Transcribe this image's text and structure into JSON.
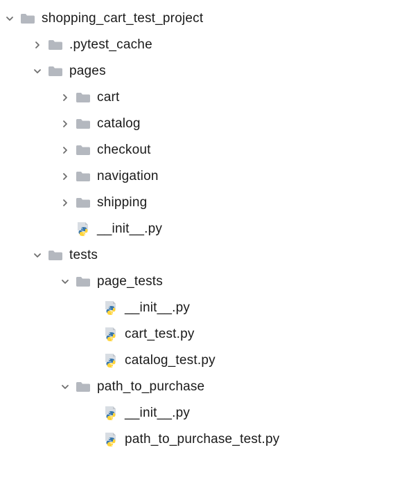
{
  "tree": [
    {
      "id": "root",
      "depth": 0,
      "expanded": true,
      "type": "folder",
      "label": "shopping_cart_test_project"
    },
    {
      "id": "pytest_cache",
      "depth": 1,
      "expanded": false,
      "type": "folder",
      "label": ".pytest_cache"
    },
    {
      "id": "pages",
      "depth": 1,
      "expanded": true,
      "type": "folder",
      "label": "pages"
    },
    {
      "id": "pages_cart",
      "depth": 2,
      "expanded": false,
      "type": "folder",
      "label": "cart"
    },
    {
      "id": "pages_catalog",
      "depth": 2,
      "expanded": false,
      "type": "folder",
      "label": "catalog"
    },
    {
      "id": "pages_checkout",
      "depth": 2,
      "expanded": false,
      "type": "folder",
      "label": "checkout"
    },
    {
      "id": "pages_navigation",
      "depth": 2,
      "expanded": false,
      "type": "folder",
      "label": "navigation"
    },
    {
      "id": "pages_shipping",
      "depth": 2,
      "expanded": false,
      "type": "folder",
      "label": "shipping"
    },
    {
      "id": "pages_init",
      "depth": 2,
      "expanded": null,
      "type": "pyfile",
      "label": "__init__.py"
    },
    {
      "id": "tests",
      "depth": 1,
      "expanded": true,
      "type": "folder",
      "label": "tests"
    },
    {
      "id": "tests_page_tests",
      "depth": 2,
      "expanded": true,
      "type": "folder",
      "label": "page_tests"
    },
    {
      "id": "tests_page_tests_init",
      "depth": 3,
      "expanded": null,
      "type": "pyfile",
      "label": "__init__.py"
    },
    {
      "id": "tests_page_tests_cart",
      "depth": 3,
      "expanded": null,
      "type": "pyfile",
      "label": "cart_test.py"
    },
    {
      "id": "tests_page_tests_catalog",
      "depth": 3,
      "expanded": null,
      "type": "pyfile",
      "label": "catalog_test.py"
    },
    {
      "id": "tests_ptp",
      "depth": 2,
      "expanded": true,
      "type": "folder",
      "label": "path_to_purchase"
    },
    {
      "id": "tests_ptp_init",
      "depth": 3,
      "expanded": null,
      "type": "pyfile",
      "label": "__init__.py"
    },
    {
      "id": "tests_ptp_test",
      "depth": 3,
      "expanded": null,
      "type": "pyfile",
      "label": "path_to_purchase_test.py"
    }
  ],
  "colors": {
    "chevron": "#6e6e6e",
    "folder": "#b4b8bf",
    "py_page": "#d8dde3",
    "py_snake_blue": "#3776ab",
    "py_snake_yellow": "#ffd43b"
  }
}
